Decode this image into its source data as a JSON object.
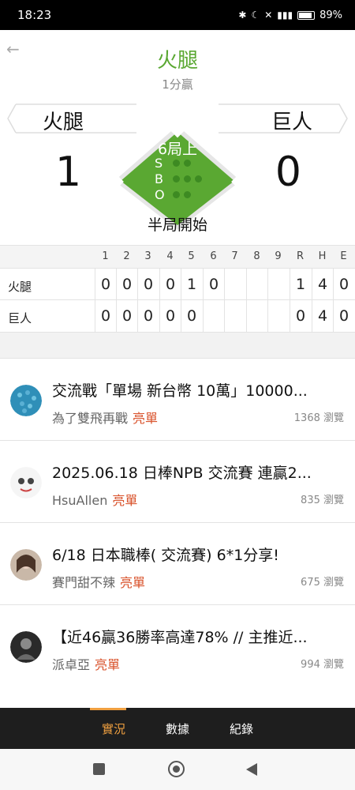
{
  "status": {
    "time": "18:23",
    "battery": "89%"
  },
  "game": {
    "winner": "火腿",
    "margin": "1分贏",
    "away_team": "火腿",
    "home_team": "巨人",
    "away_score": "1",
    "home_score": "0",
    "inning": "6局上",
    "half_status": "半局開始",
    "count_labels": [
      "S",
      "B",
      "O"
    ]
  },
  "linescore": {
    "headers": [
      "1",
      "2",
      "3",
      "4",
      "5",
      "6",
      "7",
      "8",
      "9",
      "R",
      "H",
      "E"
    ],
    "rows": [
      {
        "team": "火腿",
        "cells": [
          "0",
          "0",
          "0",
          "0",
          "1",
          "0",
          "",
          "",
          "",
          "1",
          "4",
          "0"
        ]
      },
      {
        "team": "巨人",
        "cells": [
          "0",
          "0",
          "0",
          "0",
          "0",
          "",
          "",
          "",
          "",
          "0",
          "4",
          "0"
        ]
      }
    ]
  },
  "posts": [
    {
      "title": "交流戰「單場 新台幣 10萬」10000...",
      "author": "為了雙飛再戰",
      "badge": "亮單",
      "views": "1368 瀏覽"
    },
    {
      "title": "2025.06.18 日棒NPB 交流賽 連贏2...",
      "author": "HsuAllen",
      "badge": "亮單",
      "views": "835 瀏覽"
    },
    {
      "title": "6/18 日本職棒( 交流賽) 6*1分享!",
      "author": "賽門甜不辣",
      "badge": "亮單",
      "views": "675 瀏覽"
    },
    {
      "title": "【近46贏36勝率高達78% // 主推近...",
      "author": "派卓亞",
      "badge": "亮單",
      "views": "994 瀏覽"
    }
  ],
  "tabs": [
    "實況",
    "數據",
    "紀錄"
  ],
  "colors": {
    "accent_green": "#5aa832",
    "badge_red": "#d9532c",
    "tab_active": "#f0a040"
  },
  "icons": [
    "back-arrow-icon",
    "bluetooth-icon",
    "moon-icon",
    "mute-icon",
    "signal-icon",
    "battery-icon",
    "nav-square-icon",
    "nav-home-icon",
    "nav-back-icon"
  ]
}
